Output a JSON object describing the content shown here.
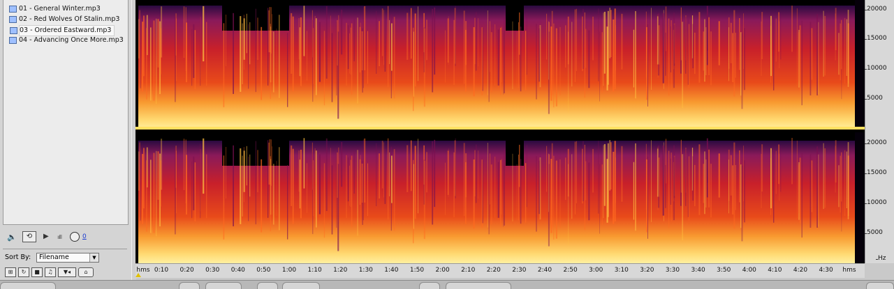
{
  "files": [
    {
      "label": "01 - General Winter.mp3",
      "selected": false
    },
    {
      "label": "02 - Red Wolves Of Stalin.mp3",
      "selected": false
    },
    {
      "label": "03 - Ordered Eastward.mp3",
      "selected": true
    },
    {
      "label": "04 - Advancing Once More.mp3",
      "selected": false
    }
  ],
  "controls": {
    "volume_value": "0"
  },
  "sort": {
    "label": "Sort By:",
    "value": "Filename"
  },
  "y_axis": {
    "top_channel_ticks": [
      "20000",
      "15000",
      "10000",
      "5000"
    ],
    "bottom_channel_ticks": [
      "20000",
      "15000",
      "10000",
      "5000"
    ],
    "unit": "Hz"
  },
  "x_axis": {
    "start_label": "hms",
    "end_label": "hms",
    "ticks": [
      "0:10",
      "0:20",
      "0:30",
      "0:40",
      "0:50",
      "1:00",
      "1:10",
      "1:20",
      "1:30",
      "1:40",
      "1:50",
      "2:00",
      "2:10",
      "2:20",
      "2:30",
      "2:40",
      "2:50",
      "3:00",
      "3:10",
      "3:20",
      "3:30",
      "3:40",
      "3:50",
      "4:00",
      "4:10",
      "4:20",
      "4:30"
    ]
  },
  "colors": {
    "spectrogram_low": "#000000",
    "spectrogram_mid": "#d0202a",
    "spectrogram_high": "#ffe070"
  }
}
